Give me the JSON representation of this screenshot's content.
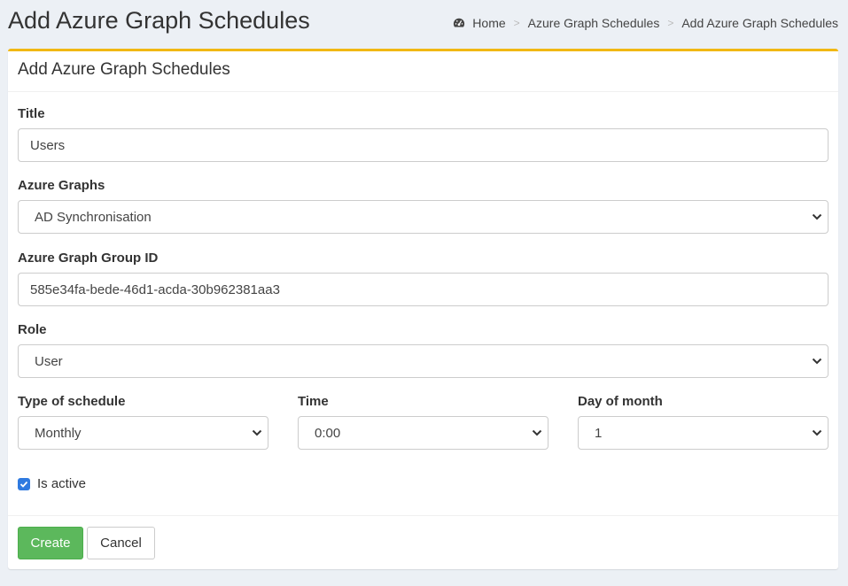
{
  "header": {
    "title": "Add Azure Graph Schedules",
    "breadcrumb": [
      "Home",
      "Azure Graph Schedules",
      "Add Azure Graph Schedules"
    ],
    "breadcrumb_separator": ">"
  },
  "box": {
    "title": "Add Azure Graph Schedules",
    "accent_color": "#f1b813"
  },
  "form": {
    "title": {
      "label": "Title",
      "value": "Users"
    },
    "azure_graphs": {
      "label": "Azure Graphs",
      "value": "AD Synchronisation"
    },
    "group_id": {
      "label": "Azure Graph Group ID",
      "value": "585e34fa-bede-46d1-acda-30b962381aa3"
    },
    "role": {
      "label": "Role",
      "value": "User"
    },
    "schedule_type": {
      "label": "Type of schedule",
      "value": "Monthly"
    },
    "time": {
      "label": "Time",
      "value": "0:00"
    },
    "day_of_month": {
      "label": "Day of month",
      "value": "1"
    },
    "is_active": {
      "label": "Is active",
      "checked": true
    }
  },
  "footer": {
    "create_label": "Create",
    "cancel_label": "Cancel",
    "create_color": "#5cb85c"
  }
}
